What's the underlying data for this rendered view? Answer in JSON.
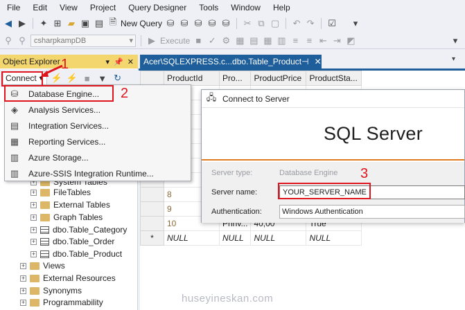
{
  "menu": [
    "File",
    "Edit",
    "View",
    "Project",
    "Query Designer",
    "Tools",
    "Window",
    "Help"
  ],
  "toolbar": {
    "new_query_label": "New Query",
    "database_value": "csharpkampDB",
    "execute_label": "Execute"
  },
  "object_explorer": {
    "title": "Object Explorer",
    "connect_label": "Connect",
    "connect_menu": [
      {
        "icon": "database-icon",
        "label": "Database Engine..."
      },
      {
        "icon": "cube-icon",
        "label": "Analysis Services..."
      },
      {
        "icon": "package-icon",
        "label": "Integration Services..."
      },
      {
        "icon": "report-icon",
        "label": "Reporting Services..."
      },
      {
        "icon": "server-icon",
        "label": "Azure Storage..."
      },
      {
        "icon": "server-icon",
        "label": "Azure-SSIS Integration Runtime..."
      }
    ],
    "tree": [
      {
        "label": "System Tables",
        "icon": "folder-icon"
      },
      {
        "label": "FileTables",
        "icon": "folder-icon"
      },
      {
        "label": "External Tables",
        "icon": "folder-icon"
      },
      {
        "label": "Graph Tables",
        "icon": "folder-icon"
      },
      {
        "label": "dbo.Table_Category",
        "icon": "table-icon"
      },
      {
        "label": "dbo.Table_Order",
        "icon": "table-icon"
      },
      {
        "label": "dbo.Table_Product",
        "icon": "table-icon"
      },
      {
        "label": "Views",
        "icon": "folder-icon"
      },
      {
        "label": "External Resources",
        "icon": "folder-icon"
      },
      {
        "label": "Synonyms",
        "icon": "folder-icon"
      },
      {
        "label": "Programmability",
        "icon": "folder-icon"
      }
    ]
  },
  "document": {
    "tab_label": "Acer\\SQLEXPRESS.c...dbo.Table_Product",
    "columns": [
      "ProductId",
      "Pro...",
      "ProductPrice",
      "ProductSta..."
    ],
    "rows": [
      [
        "8",
        "",
        "",
        ""
      ],
      [
        "9",
        "",
        "",
        ""
      ],
      [
        "10",
        "Prinv...",
        "40,00",
        "True"
      ],
      [
        "NULL",
        "NULL",
        "NULL",
        "NULL"
      ]
    ],
    "new_row_marker": "*"
  },
  "dialog": {
    "title": "Connect to Server",
    "brand": "SQL Server",
    "server_type_label": "Server type:",
    "server_type_value": "Database Engine",
    "server_name_label": "Server name:",
    "server_name_value": "YOUR_SERVER_NAME",
    "auth_label": "Authentication:",
    "auth_value": "Windows Authentication"
  },
  "annotations": [
    "1",
    "2",
    "3"
  ],
  "watermark": "huseyineskan.com",
  "colors": {
    "accent_tab": "#1e5e9b",
    "oe_title": "#f4d66e",
    "annotation_red": "#e0141c",
    "brand_line": "#e07a1f"
  }
}
